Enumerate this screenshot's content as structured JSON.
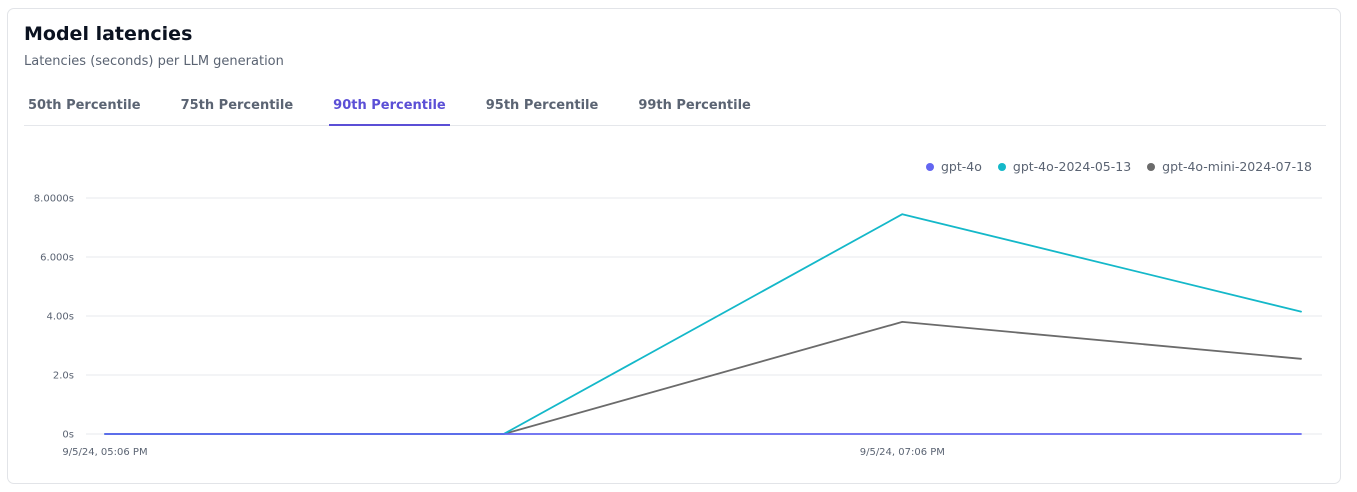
{
  "card": {
    "title": "Model latencies",
    "subtitle": "Latencies (seconds) per LLM generation"
  },
  "tabs": [
    {
      "label": "50th Percentile",
      "active": false
    },
    {
      "label": "75th Percentile",
      "active": false
    },
    {
      "label": "90th Percentile",
      "active": true
    },
    {
      "label": "95th Percentile",
      "active": false
    },
    {
      "label": "99th Percentile",
      "active": false
    }
  ],
  "chart_data": {
    "type": "line",
    "title": "",
    "xlabel": "",
    "ylabel": "",
    "x": [
      "9/5/24, 05:06 PM",
      "",
      "9/5/24, 07:06 PM",
      ""
    ],
    "x_tick_labels": [
      "9/5/24, 05:06 PM",
      "9/5/24, 07:06 PM"
    ],
    "y_ticks": [
      0,
      2,
      4,
      6,
      8
    ],
    "y_tick_labels": [
      "0s",
      "2.0s",
      "4.00s",
      "6.000s",
      "8.0000s"
    ],
    "ylim": [
      0,
      8
    ],
    "grid": true,
    "legend_position": "top-right",
    "series": [
      {
        "name": "gpt-4o",
        "color": "#6366f1",
        "values": [
          0,
          0,
          0,
          0
        ]
      },
      {
        "name": "gpt-4o-2024-05-13",
        "color": "#14b8c9",
        "values": [
          0,
          0,
          7.45,
          4.15
        ]
      },
      {
        "name": "gpt-4o-mini-2024-07-18",
        "color": "#6b6b6b",
        "values": [
          0,
          0,
          3.8,
          2.55
        ]
      }
    ]
  }
}
